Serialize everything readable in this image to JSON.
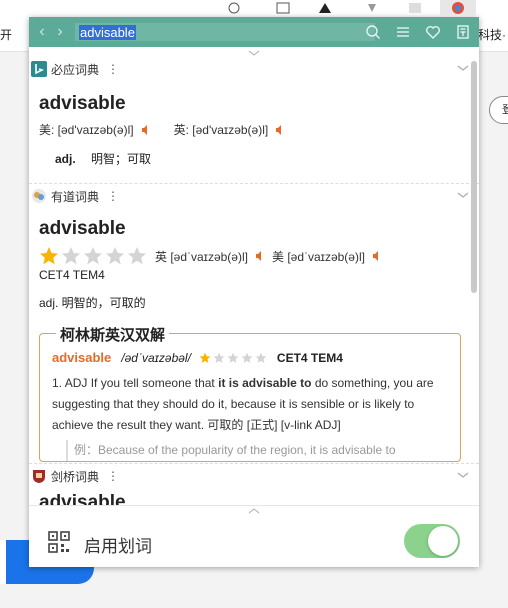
{
  "browser": {
    "bookmark_left": "开",
    "bookmark_right": "科技·",
    "side_button": "登"
  },
  "popup": {
    "search": {
      "value": "advisable"
    },
    "bottom": {
      "label": "启用划词",
      "toggle_on": true
    },
    "accent_color": "#5caa98"
  },
  "bing": {
    "name": "必应词典",
    "word": "advisable",
    "phon_us": "美: [əd'vaɪzəb(ə)l]",
    "phon_uk": "英: [əd'vaɪzəb(ə)l]",
    "pos": "adj.",
    "def": "明智；可取"
  },
  "youdao": {
    "name": "有道词典",
    "word": "advisable",
    "stars": 1,
    "stars_total": 5,
    "phon_uk": "英 [ədˈvaɪzəb(ə)l]",
    "phon_us": "美 [ədˈvaɪzəb(ə)l]",
    "tags": "CET4 TEM4",
    "def": "adj. 明智的，可取的",
    "collins": {
      "title": "柯林斯英汉双解",
      "word": "advisable",
      "phon": "/ədˈvaɪzəbəl/",
      "stars": 1,
      "stars_total": 5,
      "tags": "CET4 TEM4",
      "item_num": "1.",
      "item_pre": "ADJ If you tell someone that ",
      "item_bold1": "it is",
      "item_mid1": " ",
      "item_bold2": "advisable to",
      "item_post": " do something, you are suggesting that they should do it, because it is sensible or is likely to achieve the result they want. 可取的 [正式] [v-link ADJ]",
      "example": "例：Because of the popularity of the region, it is advisable to"
    }
  },
  "cambridge": {
    "name": "剑桥词典",
    "word": "advisable"
  },
  "colors": {
    "star_on": "#f7b500",
    "star_off": "#d4d4d4",
    "speaker": "#e46b25",
    "toggle": "#8bd28c"
  }
}
